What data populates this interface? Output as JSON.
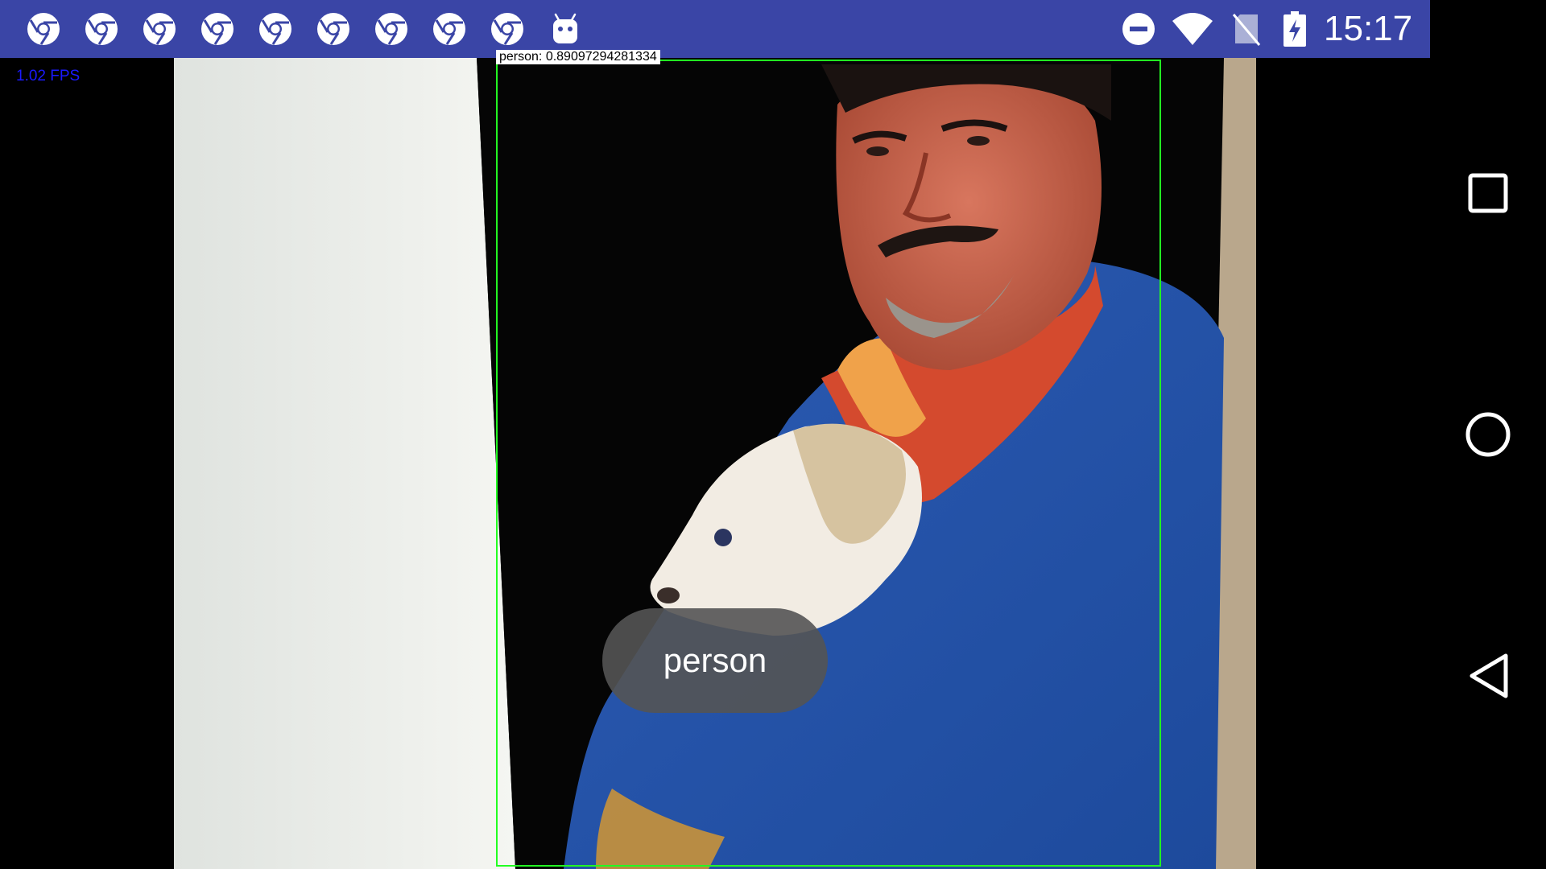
{
  "status_bar": {
    "time": "15:17",
    "color": "#3a45a6",
    "notification_icons": [
      "chrome-icon",
      "chrome-icon",
      "chrome-icon",
      "chrome-icon",
      "chrome-icon",
      "chrome-icon",
      "chrome-icon",
      "chrome-icon",
      "chrome-icon",
      "android-icon"
    ],
    "system_icons": [
      "do-not-disturb-icon",
      "wifi-icon",
      "no-sim-icon",
      "battery-charging-icon"
    ]
  },
  "camera": {
    "fps": "1.02 FPS",
    "detection": {
      "label": "person: 0.89097294281334",
      "box_color": "#22ff22"
    }
  },
  "toast": {
    "text": "person"
  },
  "nav_bar": {
    "buttons": [
      "recents-button",
      "home-button",
      "back-button"
    ]
  }
}
